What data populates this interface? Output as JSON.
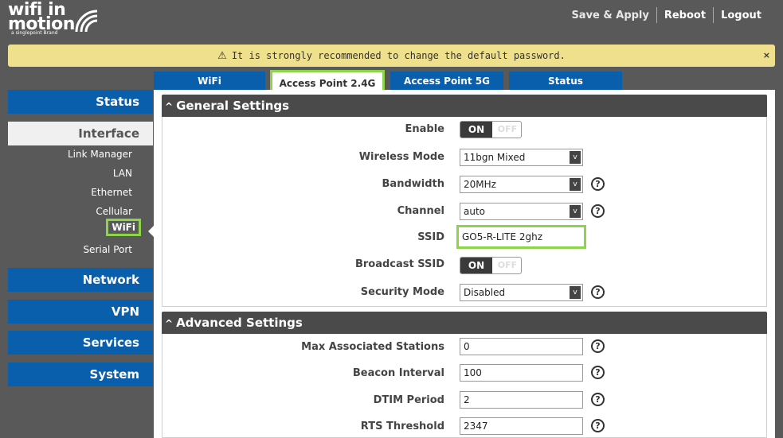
{
  "brand": {
    "line1": "wifi in",
    "line2": "motion",
    "tagline": "a singlepoint Brand"
  },
  "header": {
    "save_apply": "Save & Apply",
    "reboot": "Reboot",
    "logout": "Logout"
  },
  "warning": {
    "text": "It is strongly recommended to change the default password.",
    "close": "×"
  },
  "tabs": [
    {
      "label": "WiFi"
    },
    {
      "label": "Access Point 2.4G"
    },
    {
      "label": "Access Point 5G"
    },
    {
      "label": "Status"
    }
  ],
  "sidebar": {
    "status": "Status",
    "interface": "Interface",
    "interface_items": [
      "Link Manager",
      "LAN",
      "Ethernet",
      "Cellular",
      "WiFi",
      "Serial Port"
    ],
    "network": "Network",
    "vpn": "VPN",
    "services": "Services",
    "system": "System"
  },
  "general": {
    "title": "General Settings",
    "enable_label": "Enable",
    "wireless_mode_label": "Wireless Mode",
    "wireless_mode_value": "11bgn Mixed",
    "bandwidth_label": "Bandwidth",
    "bandwidth_value": "20MHz",
    "channel_label": "Channel",
    "channel_value": "auto",
    "ssid_label": "SSID",
    "ssid_value": "GO5-R-LITE 2ghz",
    "broadcast_label": "Broadcast SSID",
    "security_label": "Security Mode",
    "security_value": "Disabled"
  },
  "toggle": {
    "on": "ON",
    "off": "OFF"
  },
  "advanced": {
    "title": "Advanced Settings",
    "max_stations_label": "Max Associated Stations",
    "max_stations_value": "0",
    "beacon_label": "Beacon Interval",
    "beacon_value": "100",
    "dtim_label": "DTIM Period",
    "dtim_value": "2",
    "rts_label": "RTS Threshold",
    "rts_value": "2347"
  },
  "help_glyph": "?",
  "colors": {
    "accent": "#0a5fad",
    "highlight": "#8cd44a",
    "warning": "#efe08d",
    "header": "#595959"
  }
}
